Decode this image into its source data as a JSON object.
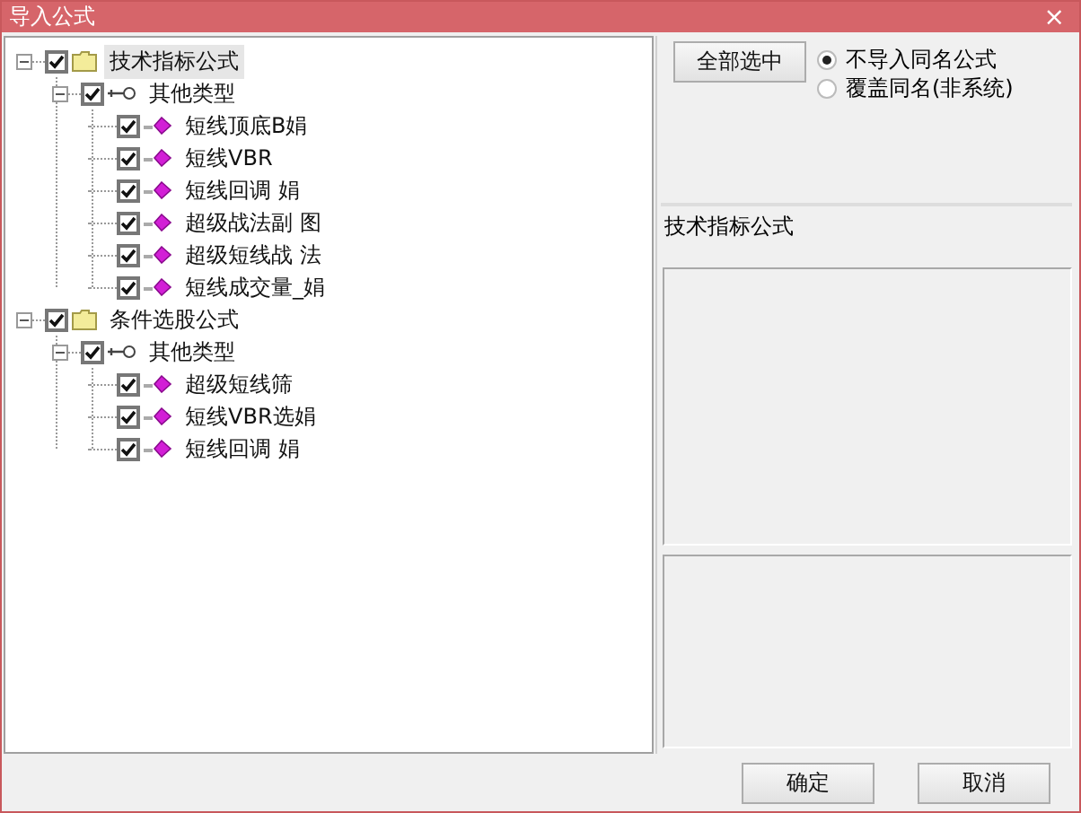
{
  "window": {
    "title": "导入公式",
    "close": "×"
  },
  "tree": [
    {
      "kind": "folder",
      "label": "技术指标公式",
      "checked": true,
      "expanded": true,
      "selected": true,
      "children": [
        {
          "kind": "group",
          "label": "其他类型",
          "checked": true,
          "expanded": true,
          "selected": false,
          "children": [
            {
              "kind": "formula",
              "label": "短线顶底B娟",
              "checked": true,
              "selected": false
            },
            {
              "kind": "formula",
              "label": "短线VBR",
              "checked": true,
              "selected": false
            },
            {
              "kind": "formula",
              "label": "短线回调 娟",
              "checked": true,
              "selected": false
            },
            {
              "kind": "formula",
              "label": "超级战法副 图",
              "checked": true,
              "selected": false
            },
            {
              "kind": "formula",
              "label": "超级短线战 法",
              "checked": true,
              "selected": false
            },
            {
              "kind": "formula",
              "label": "短线成交量_娟",
              "checked": true,
              "selected": false
            }
          ]
        }
      ]
    },
    {
      "kind": "folder",
      "label": "条件选股公式",
      "checked": true,
      "expanded": true,
      "selected": false,
      "children": [
        {
          "kind": "group",
          "label": "其他类型",
          "checked": true,
          "expanded": true,
          "selected": false,
          "children": [
            {
              "kind": "formula",
              "label": "超级短线筛",
              "checked": true,
              "selected": false
            },
            {
              "kind": "formula",
              "label": "短线VBR选娟",
              "checked": true,
              "selected": false
            },
            {
              "kind": "formula",
              "label": "短线回调 娟",
              "checked": true,
              "selected": false
            }
          ]
        }
      ]
    }
  ],
  "select_all_button": "全部选中",
  "options": [
    {
      "label": "不导入同名公式",
      "selected": true
    },
    {
      "label": "覆盖同名(非系统)",
      "selected": false
    }
  ],
  "category_label": "技术指标公式",
  "buttons": [
    {
      "label": "确定"
    },
    {
      "label": "取消"
    }
  ]
}
